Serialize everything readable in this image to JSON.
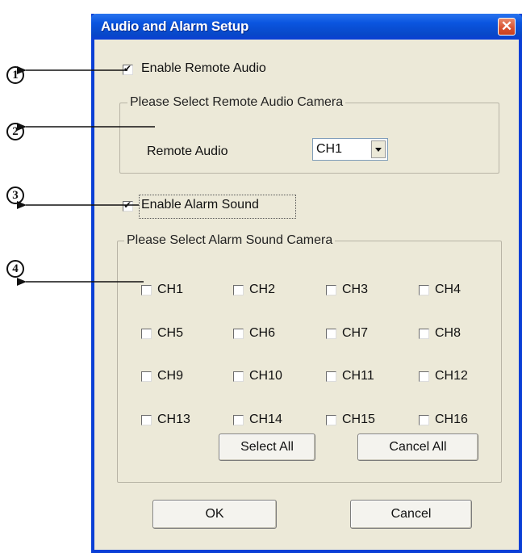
{
  "window": {
    "title": "Audio and Alarm Setup",
    "close_symbol": "✕"
  },
  "remote_audio": {
    "enable_label": "Enable Remote Audio",
    "enable_checked": true,
    "group_title": "Please Select Remote Audio Camera",
    "field_label": "Remote Audio",
    "selected_value": "CH1"
  },
  "alarm": {
    "enable_label": "Enable Alarm Sound",
    "enable_checked": true,
    "group_title": "Please Select Alarm Sound Camera",
    "channels": [
      "CH1",
      "CH2",
      "CH3",
      "CH4",
      "CH5",
      "CH6",
      "CH7",
      "CH8",
      "CH9",
      "CH10",
      "CH11",
      "CH12",
      "CH13",
      "CH14",
      "CH15",
      "CH16"
    ],
    "select_all_label": "Select All",
    "cancel_all_label": "Cancel All"
  },
  "buttons": {
    "ok_label": "OK",
    "cancel_label": "Cancel"
  },
  "callouts": [
    "1",
    "2",
    "3",
    "4"
  ],
  "colors": {
    "title_bar": "#0a55e0",
    "dialog_bg": "#ece9d8",
    "close_button": "#d9512f"
  }
}
